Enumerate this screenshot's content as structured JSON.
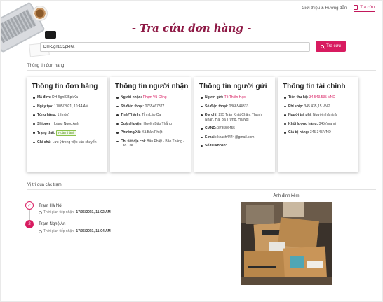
{
  "nav": {
    "intro": "Giới thiệu & Hướng dẫn",
    "lookup": "Tra cứu"
  },
  "title": "- Tra cứu đơn hàng -",
  "search": {
    "value": "DH-5gn835pkKa",
    "button": "Tra cứu"
  },
  "section_order_info": "Thông tin đơn hàng",
  "cards": {
    "order": {
      "title": "Thông tin đơn hàng",
      "code_label": "Mã đơn:",
      "code": "DH-5gn835pkKa",
      "date_label": "Ngày tạo:",
      "date": "17/05/2021, 10:44 AM",
      "total_label": "Tổng hàng:",
      "total": "1 (món)",
      "shipper_label": "Shipper:",
      "shipper": "Hoàng Ngọc Anh",
      "status_label": "Trạng thái:",
      "status": "Hoàn thành",
      "note_label": "Ghi chú:",
      "note": "Lưu ý trong việc vận chuyển"
    },
    "receiver": {
      "title": "Thông tin người nhận",
      "name_label": "Người nhận:",
      "name": "Phạm Vũ Công",
      "phone_label": "Số điện thoại:",
      "phone": "0765467877",
      "province_label": "Tỉnh/Thành:",
      "province": "Tỉnh Lào Cai",
      "district_label": "Quận/Huyện:",
      "district": "Huyện Bảo Thắng",
      "ward_label": "Phường/Xã:",
      "ward": "Xã Bản Phiệt",
      "address_label": "Chi tiết địa chỉ:",
      "address": "Bản Phiệt - Bảo Thắng - Lào Cai"
    },
    "sender": {
      "title": "Thông tin người gửi",
      "name_label": "Người gửi:",
      "name": "Tô Thiên Hạo",
      "phone_label": "Số điện thoại:",
      "phone": "0866544333",
      "address_label": "Địa chỉ:",
      "address": "295 Trần Khát Chân, Thanh Nhàn, Hai Bà Trưng, Hà Nội",
      "id_label": "CMND:",
      "id": "373556455",
      "email_label": "E-mail:",
      "email": "khach4444@gmail.com",
      "account_label": "Số tài khoản:",
      "account": ""
    },
    "finance": {
      "title": "Thông tin tài chính",
      "cod_label": "Tiền thu hộ:",
      "cod": "34.543.535 VNĐ",
      "fee_label": "Phí ship:",
      "fee": "345.435,15 VNĐ",
      "payer_label": "Người trả phí:",
      "payer": "Người nhận trả",
      "weight_label": "Khối lượng hàng:",
      "weight": "345 (gram)",
      "value_label": "Giá trị hàng:",
      "value": "345.345 VNĐ"
    }
  },
  "section_location": "Vị trí qua các trạm",
  "timeline": [
    {
      "marker": "✓",
      "station": "Trạm Hà Nội",
      "time_label": "Thời gian tiếp nhận:",
      "time": "17/05/2021, 11:02 AM"
    },
    {
      "marker": "2",
      "station": "Trạm Nghệ An",
      "time_label": "Thời gian tiếp nhận:",
      "time": "17/05/2021, 11:04 AM"
    }
  ],
  "attachment_label": "Ảnh đính kèm",
  "colors": {
    "accent": "#d81b60",
    "title": "#8e1945",
    "success": "#8bc34a"
  }
}
